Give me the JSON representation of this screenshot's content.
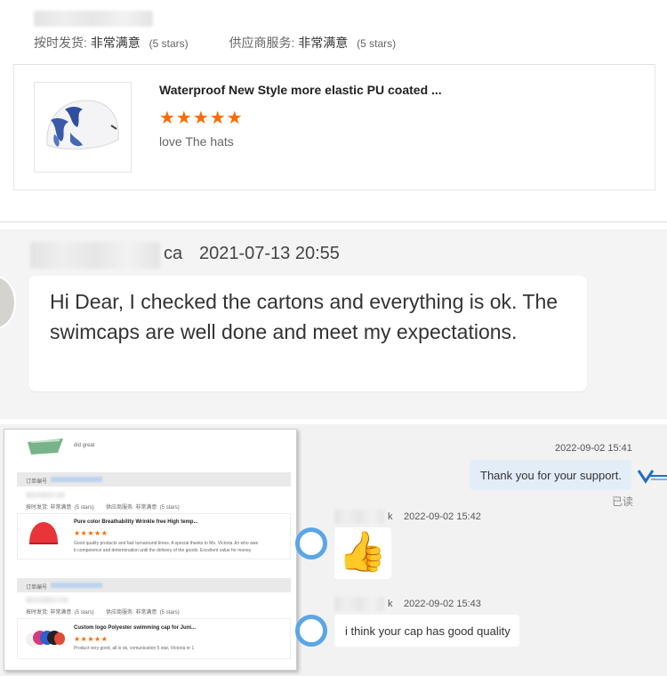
{
  "panel1": {
    "rating_shipping_label": "按时发货:",
    "rating_shipping_value": "非常满意",
    "rating_shipping_stars": "(5 stars)",
    "rating_service_label": "供应商服务:",
    "rating_service_value": "非常满意",
    "rating_service_stars": "(5 stars)",
    "product_title": "Waterproof New Style more elastic PU coated ...",
    "stars": "★★★★★",
    "review_text": "love The hats"
  },
  "panel2": {
    "sender_name_tail": "ca",
    "timestamp": "2021-07-13 20:55",
    "message": "Hi Dear, I checked the cartons and everything is ok. The swimcaps are well done and meet my expectations."
  },
  "panel3": {
    "inset": {
      "top_review": "did great",
      "order_label": "订单编号",
      "order1": {
        "shipping": "按时发货: 非常满意",
        "shipping_stars": "(5 stars)",
        "service": "供应商服务: 非常满意",
        "service_stars": "(5 stars)",
        "product_title": "Pure color Breathability Wrinkle free High temp...",
        "stars": "★★★★★",
        "review_line1": "Good quality products and fast turnaround times.  A special thanks to Ms. Victoria Jin who awe",
        "review_line2": "b competence and determination until the delivery of the goods.  Excellent value for money"
      },
      "order2": {
        "shipping": "按时发货: 非常满意",
        "shipping_stars": "(5 stars)",
        "service": "供应商服务: 非常满意",
        "service_stars": "(5 stars)",
        "product_title": "Custom logo Polyester swimming cap for Juni...",
        "stars": "★★★★★",
        "review_line1": "Product very good, all is ok, comunication 5 star, Victoria nr 1"
      }
    },
    "chat": {
      "outgoing_time": "2022-09-02 15:41",
      "outgoing_message": "Thank you for your support.",
      "read_status": "已读",
      "incoming1_name_tail": "k",
      "incoming1_time": "2022-09-02 15:42",
      "incoming1_emoji": "👍",
      "incoming2_name_tail": "k",
      "incoming2_time": "2022-09-02 15:43",
      "incoming2_message": "i think your cap has good quality"
    }
  }
}
